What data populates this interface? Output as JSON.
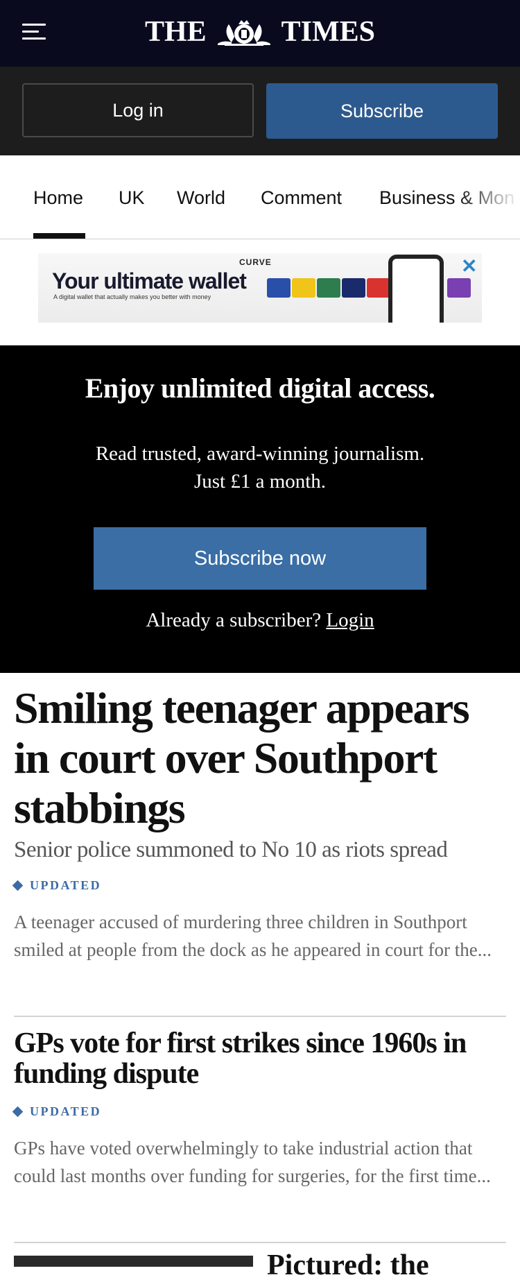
{
  "header": {
    "masthead_left": "THE",
    "masthead_right": "TIMES",
    "menu_icon": "hamburger-menu-icon",
    "crest_icon": "royal-crest-icon"
  },
  "auth": {
    "login_label": "Log in",
    "subscribe_label": "Subscribe"
  },
  "nav": {
    "items": [
      {
        "label": "Home",
        "active": true
      },
      {
        "label": "UK"
      },
      {
        "label": "World"
      },
      {
        "label": "Comment"
      },
      {
        "label": "Business & Mon"
      }
    ]
  },
  "ad": {
    "brand": "CURVE",
    "headline": "Your ultimate wallet",
    "subline": "A digital wallet that actually makes you better with money",
    "close_icon": "close-icon"
  },
  "promo": {
    "title": "Enjoy unlimited digital access.",
    "body_line1": "Read trusted, award-winning journalism.",
    "body_line2": "Just £1 a month.",
    "button_label": "Subscribe now",
    "already_text": "Already a subscriber?",
    "login_link": "Login"
  },
  "articles": [
    {
      "headline": "Smiling teenager appears in court over Southport stabbings",
      "subheadline": "Senior police summoned to No 10 as riots spread",
      "badge": "UPDATED",
      "summary": "A teenager accused of murdering three children in Southport smiled at people from the dock as he appeared in court for the..."
    },
    {
      "headline": "GPs vote for first strikes since 1960s in funding dispute",
      "badge": "UPDATED",
      "summary": "GPs have voted overwhelmingly to take industrial action that could last months over funding for surgeries, for the first time..."
    },
    {
      "headline": "Pictured: the"
    }
  ],
  "colors": {
    "topbar": "#0a0a1f",
    "authbar": "#1d1d1d",
    "subscribe_blue": "#2d5a8e",
    "promo_button": "#3a6ea5",
    "badge_blue": "#3d6ba5"
  }
}
